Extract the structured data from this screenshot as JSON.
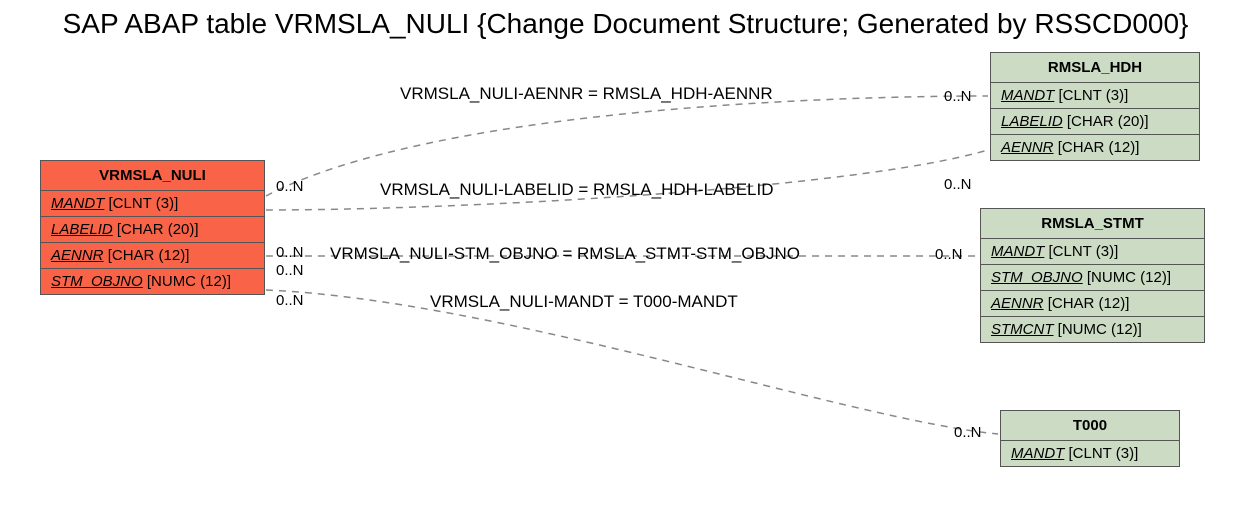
{
  "title": "SAP ABAP table VRMSLA_NULI {Change Document Structure; Generated by RSSCD000}",
  "entities": {
    "vrmsla": {
      "name": "VRMSLA_NULI",
      "fields": [
        {
          "name": "MANDT",
          "type": "[CLNT (3)]"
        },
        {
          "name": "LABELID",
          "type": "[CHAR (20)]"
        },
        {
          "name": "AENNR",
          "type": "[CHAR (12)]"
        },
        {
          "name": "STM_OBJNO",
          "type": "[NUMC (12)]"
        }
      ]
    },
    "hdh": {
      "name": "RMSLA_HDH",
      "fields": [
        {
          "name": "MANDT",
          "type": "[CLNT (3)]"
        },
        {
          "name": "LABELID",
          "type": "[CHAR (20)]"
        },
        {
          "name": "AENNR",
          "type": "[CHAR (12)]"
        }
      ]
    },
    "stmt": {
      "name": "RMSLA_STMT",
      "fields": [
        {
          "name": "MANDT",
          "type": "[CLNT (3)]"
        },
        {
          "name": "STM_OBJNO",
          "type": "[NUMC (12)]"
        },
        {
          "name": "AENNR",
          "type": "[CHAR (12)]"
        },
        {
          "name": "STMCNT",
          "type": "[NUMC (12)]"
        }
      ]
    },
    "t000": {
      "name": "T000",
      "fields": [
        {
          "name": "MANDT",
          "type": "[CLNT (3)]"
        }
      ]
    }
  },
  "relations": {
    "r1": {
      "label": "VRMSLA_NULI-AENNR = RMSLA_HDH-AENNR",
      "left_card": "0..N",
      "right_card": "0..N"
    },
    "r2": {
      "label": "VRMSLA_NULI-LABELID = RMSLA_HDH-LABELID",
      "left_card": "0..N",
      "right_card": "0..N"
    },
    "r3": {
      "label": "VRMSLA_NULI-STM_OBJNO = RMSLA_STMT-STM_OBJNO",
      "left_card": "0..N",
      "right_card": "0..N"
    },
    "r4": {
      "label": "VRMSLA_NULI-MANDT = T000-MANDT",
      "left_card": "0..N",
      "right_card": "0..N"
    }
  }
}
